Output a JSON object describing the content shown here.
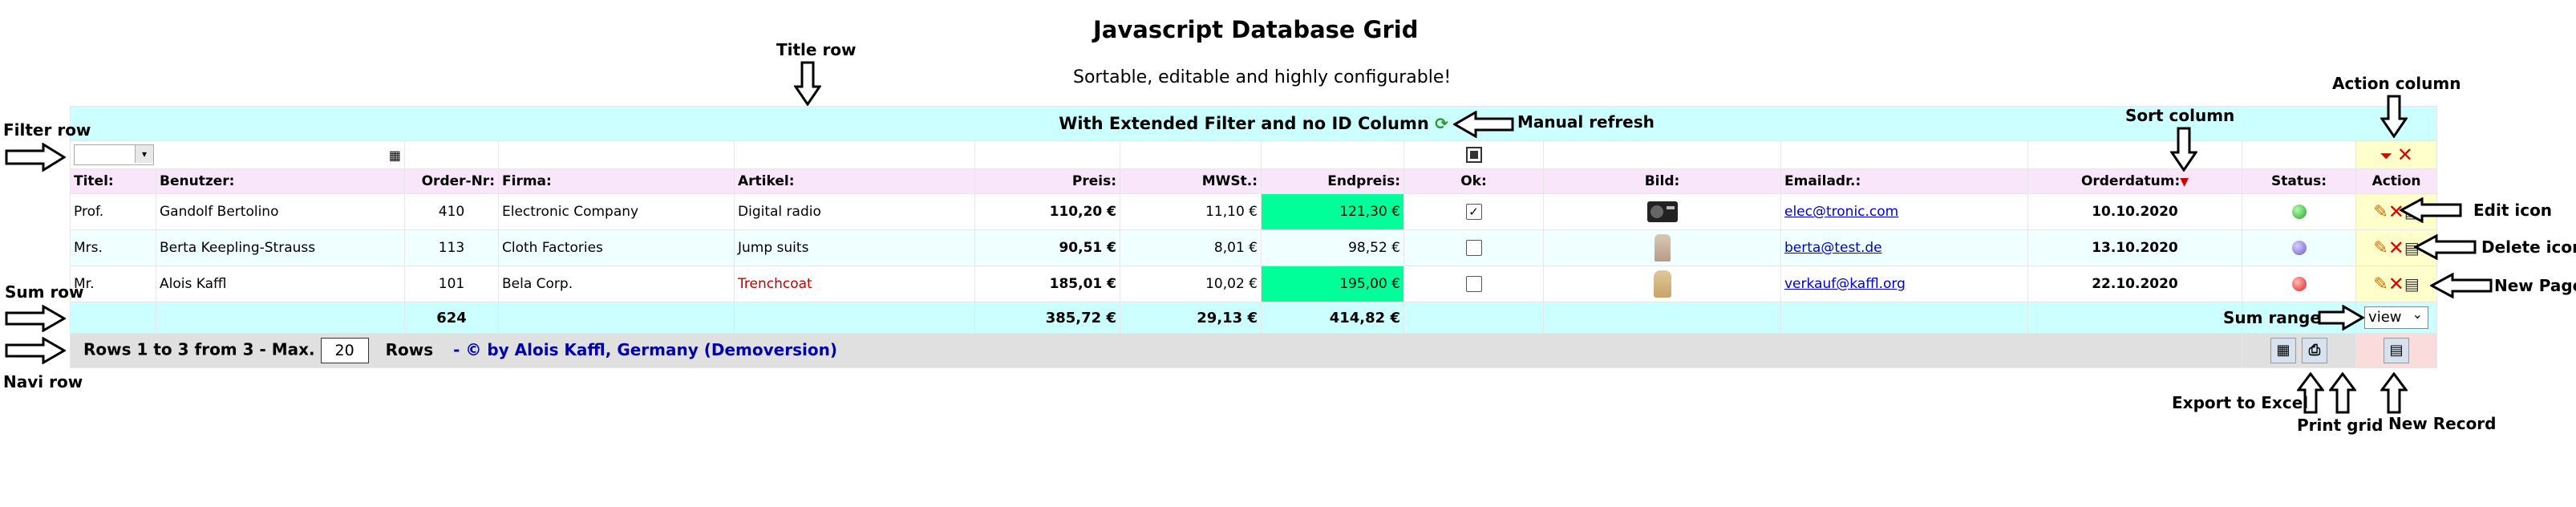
{
  "page": {
    "title": "Javascript Database Grid",
    "subtitle": "Sortable, editable and highly configurable!"
  },
  "grid": {
    "title_row": "With Extended Filter and no ID Column",
    "columns": [
      "Titel:",
      "Benutzer:",
      "Order-Nr:",
      "Firma:",
      "Artikel:",
      "Preis:",
      "MWSt.:",
      "Endpreis:",
      "Ok:",
      "Bild:",
      "Emailadr.:",
      "Orderdatum:",
      "Status:",
      "Action"
    ],
    "rows": [
      {
        "titel": "Prof.",
        "benutzer": "Gandolf Bertolino",
        "order": "410",
        "firma": "Electronic Company",
        "artikel": "Digital radio",
        "preis": "110,20 €",
        "mwst": "11,10 €",
        "endpreis": "121,30 €",
        "ok": "✓",
        "bild": "radio",
        "email": "elec@tronic.com",
        "datum": "10.10.2020",
        "status": "green"
      },
      {
        "titel": "Mrs.",
        "benutzer": "Berta Keepling-Strauss",
        "order": "113",
        "firma": "Cloth Factories",
        "artikel": "Jump suits",
        "preis": "90,51 €",
        "mwst": "8,01 €",
        "endpreis": "98,52 €",
        "ok": "",
        "bild": "jumpsuit",
        "email": "berta@test.de",
        "datum": "13.10.2020",
        "status": "purple"
      },
      {
        "titel": "Mr.",
        "benutzer": "Alois Kaffl",
        "order": "101",
        "firma": "Bela Corp.",
        "artikel": "Trenchcoat",
        "preis": "185,01 €",
        "mwst": "10,02 €",
        "endpreis": "195,00 €",
        "ok": "",
        "bild": "trenchcoat",
        "email": "verkauf@kaffl.org",
        "datum": "22.10.2020",
        "status": "red"
      }
    ],
    "sum": {
      "order": "624",
      "preis": "385,72 €",
      "mwst": "29,13 €",
      "endpreis": "414,82 €",
      "range_value": "view"
    },
    "navi": {
      "prefix": "Rows 1 to 3 from 3  - Max.",
      "max": "20",
      "suffix": "Rows",
      "copyright": "- © by Alois Kaffl, Germany (Demoversion)"
    }
  },
  "annotations": {
    "title_row": "Title row",
    "filter_row": "Filter row",
    "manual_refresh": "Manual refresh",
    "sort_column": "Sort column",
    "action_column": "Action column",
    "edit_icon": "Edit icon",
    "delete_icon": "Delete icon",
    "new_page": "New Page",
    "sum_row": "Sum row",
    "sum_range": "Sum range",
    "navi_row": "Navi row",
    "export_excel": "Export to Excel",
    "print_grid": "Print grid",
    "new_record": "New Record"
  },
  "colors": {
    "title_bg": "#ccffff",
    "header_bg": "#fae6fa",
    "highlight": "#00ff99",
    "navi_bg": "#e0e0e0"
  }
}
